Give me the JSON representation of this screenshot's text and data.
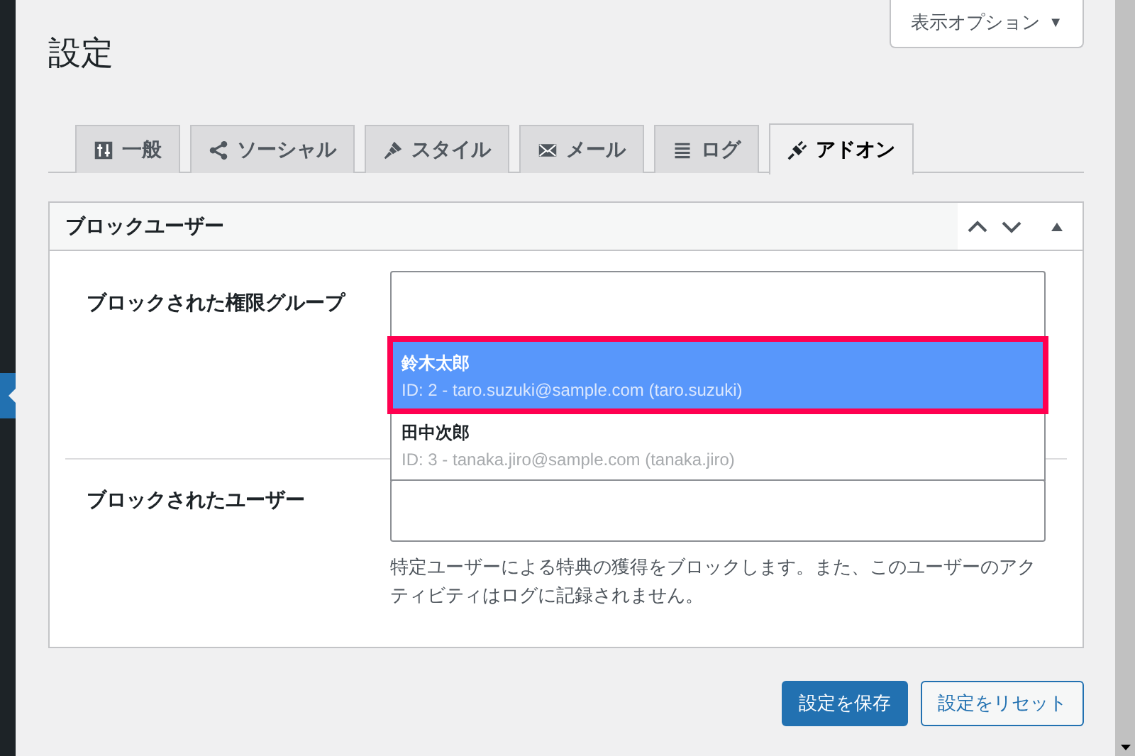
{
  "page_title": "設定",
  "screen_options": {
    "label": "表示オプション",
    "caret": "▼"
  },
  "tabs": [
    {
      "label": "一般",
      "kind": "general",
      "selected": false
    },
    {
      "label": "ソーシャル",
      "kind": "social",
      "selected": false
    },
    {
      "label": "スタイル",
      "kind": "style",
      "selected": false
    },
    {
      "label": "メール",
      "kind": "mail",
      "selected": false
    },
    {
      "label": "ログ",
      "kind": "log",
      "selected": false
    },
    {
      "label": "アドオン",
      "kind": "addon",
      "selected": true
    }
  ],
  "panel": {
    "title": "ブロックユーザー",
    "fields": [
      {
        "label": "ブロックされた権限グループ",
        "dropdown": [
          {
            "name": "鈴木太郎",
            "detail": "ID: 2 - taro.suzuki@sample.com (taro.suzuki)",
            "selected": true,
            "highlighted": true
          },
          {
            "name": "田中次郎",
            "detail": "ID: 3 - tanaka.jiro@sample.com (tanaka.jiro)",
            "selected": false,
            "highlighted": false
          }
        ]
      },
      {
        "label": "ブロックされたユーザー",
        "help": "特定ユーザーによる特典の獲得をブロックします。また、このユーザーのアクティビティはログに記録されません。"
      }
    ]
  },
  "buttons": [
    {
      "label": "設定を保存",
      "kind": "primary"
    },
    {
      "label": "設定をリセット",
      "kind": "secondary"
    }
  ]
}
